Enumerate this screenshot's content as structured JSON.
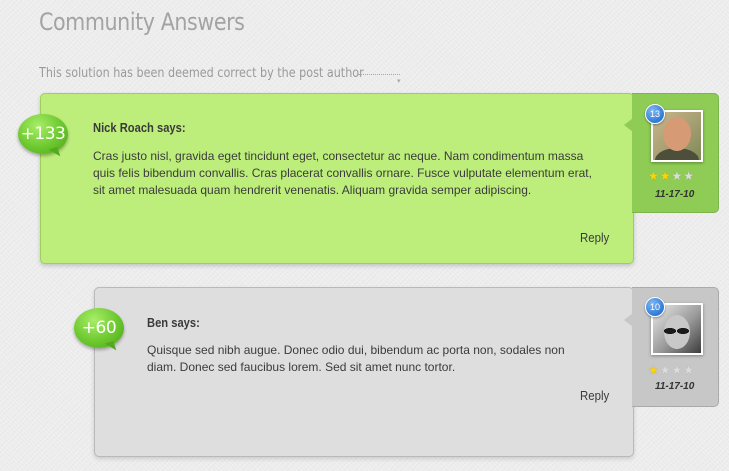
{
  "page": {
    "title": "Community Answers",
    "notice": "This solution has been deemed correct by the post author"
  },
  "answers": [
    {
      "score": "+133",
      "author_line": "Nick Roach says:",
      "body": "Cras justo nisl, gravida eget tincidunt eget, consectetur ac neque. Nam condimentum massa quis felis bibendum convallis. Cras placerat convallis ornare. Fusce vulputate elementum erat, sit amet malesuada quam hendrerit venenatis. Aliquam gravida semper adipiscing.",
      "reply_label": "Reply",
      "badge_count": "13",
      "date": "11-17-10",
      "rating": 2,
      "rating_max": 4,
      "color": "#bdee7c",
      "accepted": true
    },
    {
      "score": "+60",
      "author_line": "Ben says:",
      "body": "Quisque sed nibh augue. Donec odio dui, bibendum ac porta non, sodales non diam. Donec sed faucibus lorem. Sed sit amet nunc tortor.",
      "reply_label": "Reply",
      "badge_count": "10",
      "date": "11-17-10",
      "rating": 1,
      "rating_max": 4,
      "color": "#dedede",
      "accepted": false
    }
  ],
  "colors": {
    "accepted_bg": "#bdee7c",
    "accepted_side": "#8fcc55",
    "normal_bg": "#dedede",
    "normal_side": "#c7c7c7",
    "score_bubble": "#6cc82e",
    "badge": "#2f7ad6",
    "star_on": "#ffd400"
  }
}
